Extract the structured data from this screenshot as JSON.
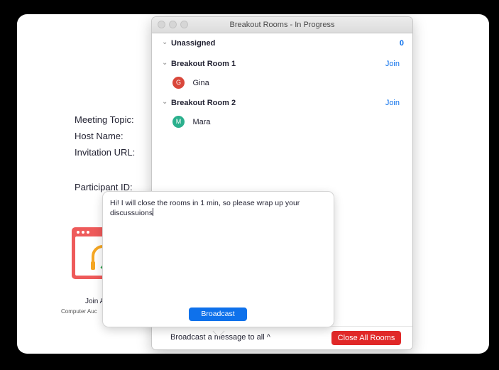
{
  "meeting_info": {
    "topic_label": "Meeting Topic:",
    "host_label": "Host Name:",
    "invite_label": "Invitation URL:",
    "participant_label": "Participant ID:"
  },
  "join_audio": {
    "label": "Join A",
    "sublabel": "Computer Auc"
  },
  "breakout_panel": {
    "title": "Breakout Rooms - In Progress",
    "unassigned": {
      "label": "Unassigned",
      "count": "0"
    },
    "rooms": [
      {
        "name": "Breakout Room 1",
        "action": "Join",
        "participants": [
          {
            "initial": "G",
            "name": "Gina",
            "color": "#d9473b"
          }
        ]
      },
      {
        "name": "Breakout Room 2",
        "action": "Join",
        "participants": [
          {
            "initial": "M",
            "name": "Mara",
            "color": "#2bb08d"
          }
        ]
      }
    ],
    "footer": {
      "broadcast_toggle": "Broadcast a message to all ^",
      "close_all": "Close All Rooms"
    }
  },
  "broadcast_popover": {
    "message": "Hi! I will close the rooms in 1 min, so please wrap up your discussuions",
    "button": "Broadcast"
  },
  "colors": {
    "accent": "#0e71eb",
    "danger": "#e02828"
  }
}
